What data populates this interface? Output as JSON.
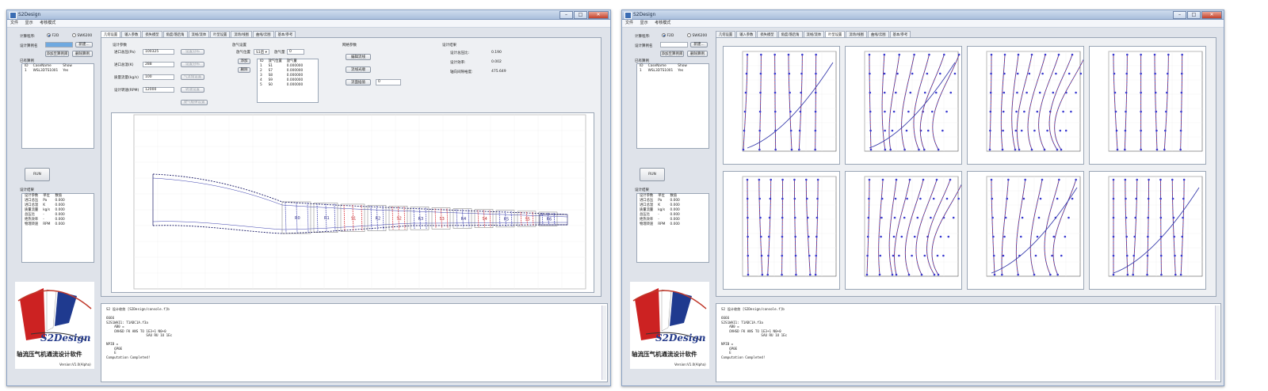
{
  "window": {
    "title": "S2Design",
    "min": "–",
    "max": "□",
    "close": "✕"
  },
  "menu": [
    "文件",
    "显示",
    "考核模式"
  ],
  "sidebar": {
    "mode_label": "计算程序:",
    "mode_options": [
      "F2D",
      "SW6200"
    ],
    "case_name_label": "设计算例名",
    "btn_new": "新建...",
    "btn_add_all": "添加至算例库",
    "btn_delete": "删除算例",
    "case_list_label": "已有算例",
    "case_columns": [
      "ID",
      "CaseName",
      "Show"
    ],
    "case_rows": [
      [
        "1",
        "WSL3DTS1001",
        "Yes"
      ]
    ],
    "run_button": "RUN",
    "results_label": "设计结果",
    "results_columns": [
      "设计参数",
      "单位",
      "数值"
    ],
    "results_rows": [
      [
        "进口总压",
        "Pa",
        "0.000"
      ],
      [
        "进口总温",
        "K",
        "0.000"
      ],
      [
        "质量流量",
        "kg/s",
        "0.000"
      ],
      [
        "总压比",
        "-",
        "0.000"
      ],
      [
        "绝热效率",
        "-",
        "0.000"
      ],
      [
        "物理转速",
        "RPM",
        "0.000"
      ]
    ]
  },
  "logo": {
    "brand": "S2Design",
    "subtitle": "轴流压气机通流设计软件",
    "version": "Version:V1.0(Alpha)"
  },
  "tabs": [
    "几何设置",
    "输入参数",
    "损失模型",
    "角度/落后角",
    "流线/流体",
    "叶型设置",
    "流场/线图",
    "曲线/云图",
    "基本/参考"
  ],
  "left_window": {
    "active_tab_index": 0,
    "geom": {
      "group_label": "设计参数",
      "fields": [
        {
          "label": "进口总压(Pa)",
          "value": "100325",
          "button": "设置分布"
        },
        {
          "label": "进口总温(K)",
          "value": "288",
          "button": "设置分布"
        },
        {
          "label": "质量流量(kg/s)",
          "value": "100",
          "button": "气流角设置"
        },
        {
          "label": "设计转速(RPM)",
          "value": "12000",
          "button": "转速设置"
        }
      ],
      "extra_button": "放气规律设置"
    },
    "bleed": {
      "group_label": "放气设置",
      "position_label": "放气位置",
      "select_value": "S1后",
      "amount_label": "放气量",
      "amount_value": "0",
      "btn_add": "添加",
      "btn_del": "删除",
      "columns": [
        "ID",
        "放气位置",
        "放气量"
      ],
      "rows": [
        [
          "1",
          "S1",
          "0.000000"
        ],
        [
          "2",
          "S7",
          "0.000000"
        ],
        [
          "3",
          "S8",
          "0.000000"
        ],
        [
          "4",
          "S9",
          "0.000000"
        ],
        [
          "5",
          "S0",
          "0.000000"
        ]
      ]
    },
    "mesh": {
      "group_label": "网格参数",
      "btn1": "编辑流线",
      "btn2": "流线光顺",
      "btn3": "流面插值",
      "btn3_value": "0"
    },
    "summary": {
      "group_label": "设计结果",
      "rows": [
        {
          "label": "设计总压比:",
          "value": "0.190"
        },
        {
          "label": "设计效率:",
          "value": "0.002"
        },
        {
          "label": "轴向间隙裕度:",
          "value": "475.649"
        }
      ]
    },
    "blade_rows": [
      "R0",
      "R1",
      "S1",
      "R2",
      "S2",
      "R3",
      "S3",
      "R4",
      "S4",
      "R5",
      "S5",
      "R6"
    ],
    "console": [
      "S2 设计收敛 [S2Design/console.f]b",
      "",
      "6666",
      "S2S1WAI1: T1ADC1A.f3a",
      "    AB0 =",
      "    OVHSD FK ANS TO 1E3+1 N0+0",
      "                    SAU RU 1U 1Ec",
      "",
      "NPIB =",
      "    6P0E",
      "    E",
      "Computation Completed!"
    ]
  },
  "right_window": {
    "active_tab_index": 5,
    "console": [
      "S2 设计收敛 [S2Design/console.f]b",
      "",
      "6666",
      "S2S1WAI1: T1ADC1A.f3a",
      "    AB0 =",
      "    OVHSD FK ANS TO 1E3+1 N0+0",
      "                    SAU RU 1U 1Ec",
      "",
      "NPIB =",
      "    6P0E",
      "    E",
      "Computation Completed!"
    ]
  },
  "colors": {
    "blue_curve": "#3b3fae",
    "red_curve": "#d9252a",
    "marker": "#3a3ad0",
    "logo_red": "#cc2222",
    "logo_blue": "#1f3a8f"
  }
}
